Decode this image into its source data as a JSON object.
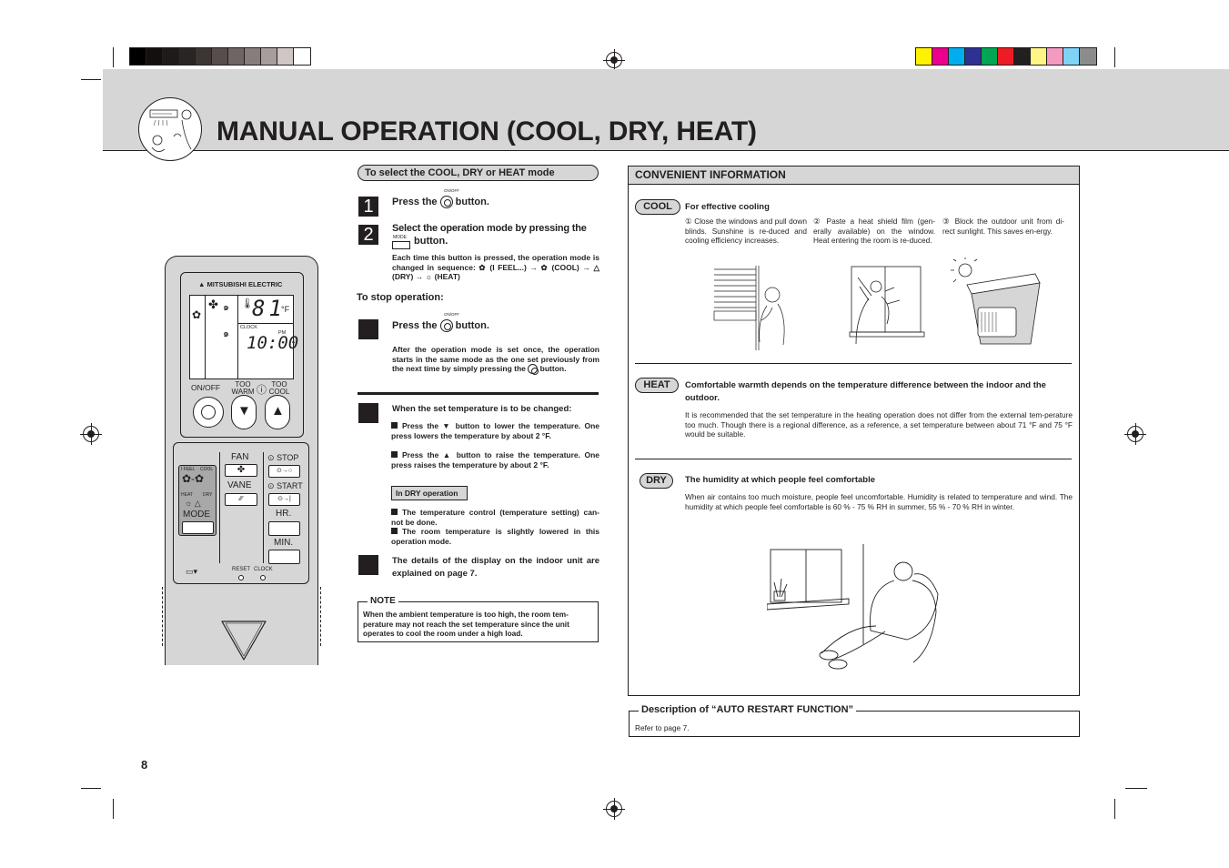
{
  "header": {
    "title": "MANUAL OPERATION (COOL, DRY, HEAT)",
    "gray_swatches": [
      "#000000",
      "#120f0e",
      "#1d1a19",
      "#2a2523",
      "#3d3533",
      "#574e4c",
      "#6f6664",
      "#877d7b",
      "#a79d9b",
      "#cfc7c5",
      "#ffffff"
    ],
    "color_swatches": [
      "#fff200",
      "#ec008c",
      "#00aeef",
      "#2e3192",
      "#00a651",
      "#ed1c24",
      "#231f20",
      "#fff685",
      "#f49ac1",
      "#7fd3f7",
      "#8c8c8c"
    ]
  },
  "mode_section": {
    "heading": "To select the COOL, DRY or HEAT mode",
    "step1": {
      "number": "1",
      "text_before": "Press the",
      "text_after": "button.",
      "button_label": "ON/OFF"
    },
    "step2": {
      "number": "2",
      "text_line1": "Select the operation mode by pressing the",
      "text_line2": "button.",
      "button_label": "MODE",
      "detail": "Each time this button is pressed, the operation mode is changed in sequence: ✿ (I FEEL...) → ✿ (COOL) → △ (DRY) → ☼ (HEAT)"
    },
    "stop_heading": "To stop operation:",
    "step3": {
      "number": "",
      "text_before": "Press the",
      "text_after": "button.",
      "button_label": "ON/OFF",
      "detail": "After the operation mode is set once, the operation starts in the same mode as the one set previously from the next time by simply pressing the",
      "detail_end": "button."
    },
    "step4": {
      "number": "",
      "heading": "When the set temperature is to be changed:",
      "bullets": [
        "Press the ▼ button to lower the temperature. One press lowers the temperature by about 2 °F.",
        "Press the ▲ button to raise the temperature. One press raises the temperature by about 2 °F."
      ]
    },
    "dry_tag": "In DRY operation",
    "dry_bullets": [
      "The temperature control (temperature setting) can-not be done.",
      "The room temperature is slightly lowered in this operation mode."
    ],
    "step5": {
      "number": "",
      "text": "The details of the display on the indoor unit are explained on page 7."
    },
    "note": {
      "label": "NOTE",
      "text": "When the ambient temperature is too high, the room tem-perature may not reach the set temperature since the unit operates to cool the room under a high load."
    }
  },
  "convenient": {
    "heading": "CONVENIENT INFORMATION",
    "cool": {
      "tag": "COOL",
      "title": "For effective cooling",
      "tips": [
        {
          "num": "①",
          "text": "Close the windows and pull down blinds. Sunshine is re-duced and cooling efficiency increases."
        },
        {
          "num": "②",
          "text": "Paste a heat shield film (gen-erally available) on the window. Heat entering the room is re-duced."
        },
        {
          "num": "③",
          "text": "Block the outdoor unit from di-rect sunlight. This saves en-ergy."
        }
      ]
    },
    "heat": {
      "tag": "HEAT",
      "title": "Comfortable warmth depends on the temperature difference between the indoor and the outdoor.",
      "text": "It is recommended that the set temperature in the heating operation does not differ from the external tem-perature too much. Though there is a regional difference, as a reference, a set temperature between about 71 °F and 75 °F would be suitable."
    },
    "dry": {
      "tag": "DRY",
      "title": "The humidity at which people feel comfortable",
      "text": "When air contains too much moisture, people feel uncomfortable. Humidity is related to temperature and wind. The humidity at which people feel comfortable is 60 % - 75 % RH in summer, 55 % - 70 % RH in winter."
    }
  },
  "auto_restart": {
    "label": "Description of “AUTO RESTART FUNCTION”",
    "text": "Refer to page 7."
  },
  "remote": {
    "brand": "MITSUBISHI ELECTRIC",
    "temp": "81",
    "unit": "°F",
    "clock_label": "CLOCK",
    "pm": "PM",
    "time": "10:00",
    "on_off": "ON/OFF",
    "too_warm": "TOO WARM",
    "too_cool": "TOO COOL",
    "fan": "FAN",
    "vane": "VANE",
    "stop": "STOP",
    "start": "START",
    "hr": "HR.",
    "min": "MIN.",
    "mode": "MODE",
    "i_feel": "I FEEL",
    "cool": "COOL",
    "heat": "HEAT",
    "dry": "DRY",
    "reset": "RESET",
    "clock": "CLOCK"
  },
  "page_number": "8"
}
